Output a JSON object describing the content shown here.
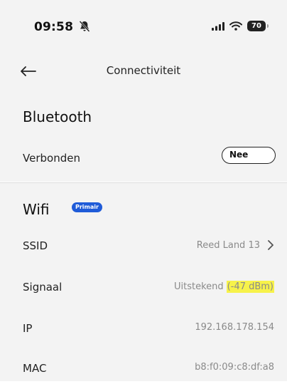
{
  "status_bar": {
    "time": "09:58",
    "battery_level": "70"
  },
  "nav": {
    "title": "Connectiviteit"
  },
  "bluetooth": {
    "title": "Bluetooth",
    "connected_label": "Verbonden",
    "connected_value": "Nee"
  },
  "wifi": {
    "title": "Wifi",
    "badge": "Primair",
    "ssid_label": "SSID",
    "ssid_value": "Reed Land 13",
    "signal_label": "Signaal",
    "signal_value": "Uitstekend",
    "signal_dbm": "(-47 dBm)",
    "ip_label": "IP",
    "ip_value": "192.168.178.154",
    "mac_label": "MAC",
    "mac_value": "b8:f0:09:c8:df:a8"
  }
}
